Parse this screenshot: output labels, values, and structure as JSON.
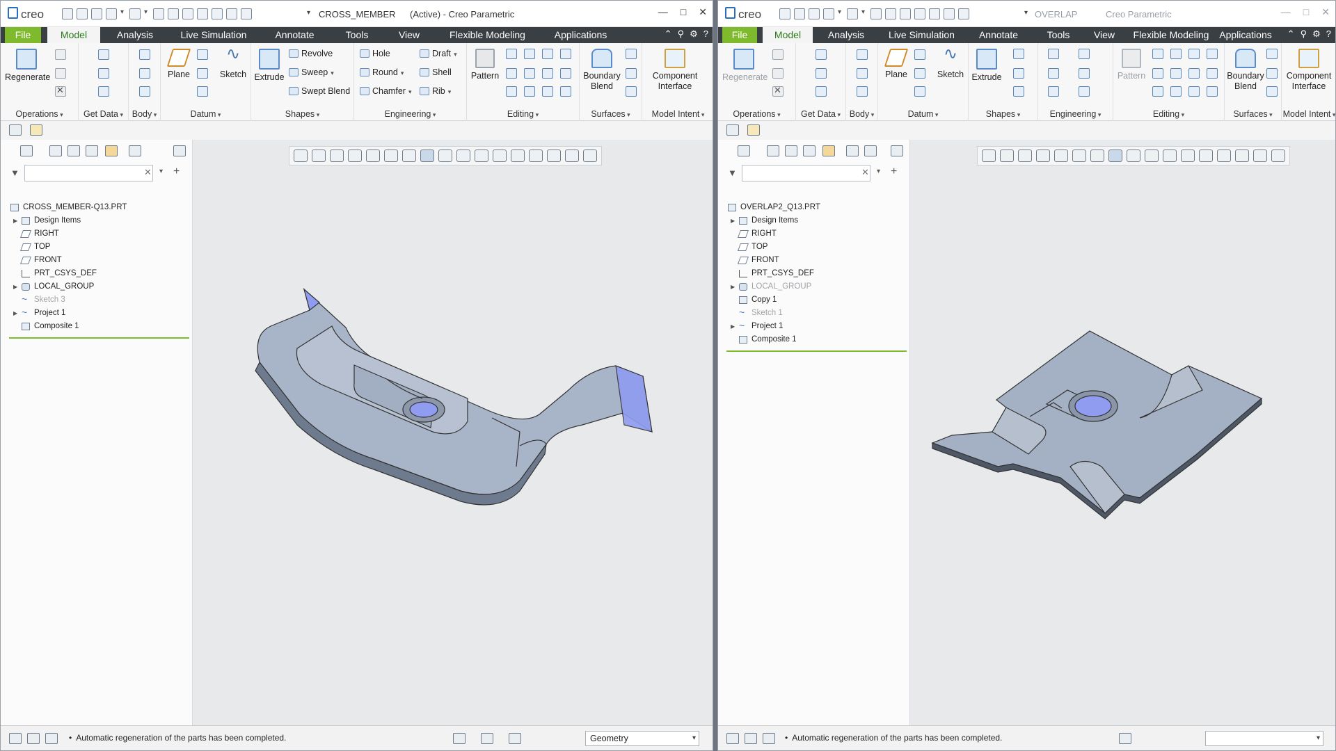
{
  "app": {
    "logo": "creo"
  },
  "left": {
    "doc_name": "CROSS_MEMBER",
    "status": "(Active) - Creo Parametric",
    "menu": [
      "File",
      "Model",
      "Analysis",
      "Live Simulation",
      "Annotate",
      "Tools",
      "View",
      "Flexible Modeling",
      "Applications"
    ],
    "ribbon": {
      "regenerate": "Regenerate",
      "plane": "Plane",
      "sketch": "Sketch",
      "extrude": "Extrude",
      "revolve": "Revolve",
      "sweep": "Sweep",
      "swept_blend": "Swept Blend",
      "hole": "Hole",
      "round": "Round",
      "chamfer": "Chamfer",
      "draft": "Draft",
      "shell": "Shell",
      "rib": "Rib",
      "pattern": "Pattern",
      "boundary": "Boundary",
      "blend": "Blend",
      "component": "Component",
      "interface": "Interface",
      "groups": [
        "Operations",
        "Get Data",
        "Body",
        "Datum",
        "Shapes",
        "Engineering",
        "Editing",
        "Surfaces",
        "Model Intent"
      ]
    },
    "tree": [
      {
        "label": "CROSS_MEMBER-Q13.PRT",
        "icon": "part",
        "expand": false,
        "dim": false,
        "root": true
      },
      {
        "label": "Design Items",
        "icon": "design",
        "expand": true,
        "dim": false
      },
      {
        "label": "RIGHT",
        "icon": "plane",
        "expand": false,
        "dim": false
      },
      {
        "label": "TOP",
        "icon": "plane",
        "expand": false,
        "dim": false
      },
      {
        "label": "FRONT",
        "icon": "plane",
        "expand": false,
        "dim": false
      },
      {
        "label": "PRT_CSYS_DEF",
        "icon": "csys",
        "expand": false,
        "dim": false
      },
      {
        "label": "LOCAL_GROUP",
        "icon": "group",
        "expand": true,
        "dim": false
      },
      {
        "label": "Sketch 3",
        "icon": "sketch",
        "expand": false,
        "dim": true
      },
      {
        "label": "Project 1",
        "icon": "sketch",
        "expand": true,
        "dim": false
      },
      {
        "label": "Composite 1",
        "icon": "design",
        "expand": false,
        "dim": false
      }
    ],
    "status_msg": "Automatic regeneration of the parts has been completed.",
    "filter_select": "Geometry"
  },
  "right": {
    "doc_name": "OVERLAP",
    "status": "Creo Parametric",
    "menu": [
      "File",
      "Model",
      "Analysis",
      "Live Simulation",
      "Annotate",
      "Tools",
      "View",
      "Flexible Modeling",
      "Applications"
    ],
    "ribbon": {
      "regenerate": "Regenerate",
      "plane": "Plane",
      "sketch": "Sketch",
      "extrude": "Extrude",
      "pattern": "Pattern",
      "boundary": "Boundary",
      "blend": "Blend",
      "component": "Component",
      "interface": "Interface",
      "groups": [
        "Operations",
        "Get Data",
        "Body",
        "Datum",
        "Shapes",
        "Engineering",
        "Editing",
        "Surfaces",
        "Model Intent"
      ]
    },
    "tree": [
      {
        "label": "OVERLAP2_Q13.PRT",
        "icon": "part",
        "expand": false,
        "dim": false,
        "root": true
      },
      {
        "label": "Design Items",
        "icon": "design",
        "expand": true,
        "dim": false
      },
      {
        "label": "RIGHT",
        "icon": "plane",
        "expand": false,
        "dim": false
      },
      {
        "label": "TOP",
        "icon": "plane",
        "expand": false,
        "dim": false
      },
      {
        "label": "FRONT",
        "icon": "plane",
        "expand": false,
        "dim": false
      },
      {
        "label": "PRT_CSYS_DEF",
        "icon": "csys",
        "expand": false,
        "dim": false
      },
      {
        "label": "LOCAL_GROUP",
        "icon": "group",
        "expand": true,
        "dim": true
      },
      {
        "label": "Copy 1",
        "icon": "design",
        "expand": false,
        "dim": false
      },
      {
        "label": "Sketch 1",
        "icon": "sketch",
        "expand": false,
        "dim": true
      },
      {
        "label": "Project 1",
        "icon": "sketch",
        "expand": true,
        "dim": false
      },
      {
        "label": "Composite 1",
        "icon": "design",
        "expand": false,
        "dim": false
      }
    ],
    "status_msg": "Automatic regeneration of the parts has been completed.",
    "filter_select": ""
  },
  "colors": {
    "file_tab": "#7fba2c",
    "menubar": "#3a3f44",
    "model_tab_text": "#2a7a1a",
    "part_face": "#9eabc0",
    "hole": "#8f9cf0"
  }
}
